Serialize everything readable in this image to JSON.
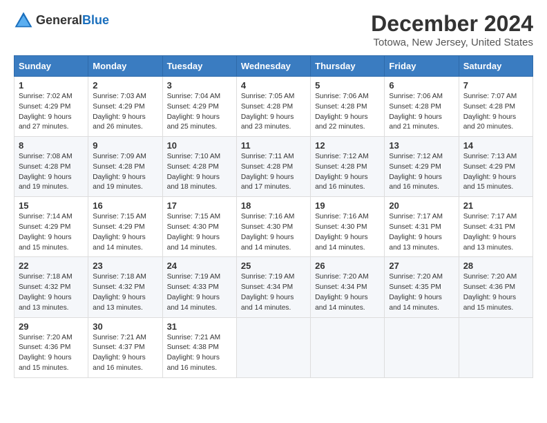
{
  "logo": {
    "general": "General",
    "blue": "Blue"
  },
  "title": "December 2024",
  "subtitle": "Totowa, New Jersey, United States",
  "days_header": [
    "Sunday",
    "Monday",
    "Tuesday",
    "Wednesday",
    "Thursday",
    "Friday",
    "Saturday"
  ],
  "weeks": [
    [
      {
        "day": "1",
        "sunrise": "Sunrise: 7:02 AM",
        "sunset": "Sunset: 4:29 PM",
        "daylight": "Daylight: 9 hours and 27 minutes."
      },
      {
        "day": "2",
        "sunrise": "Sunrise: 7:03 AM",
        "sunset": "Sunset: 4:29 PM",
        "daylight": "Daylight: 9 hours and 26 minutes."
      },
      {
        "day": "3",
        "sunrise": "Sunrise: 7:04 AM",
        "sunset": "Sunset: 4:29 PM",
        "daylight": "Daylight: 9 hours and 25 minutes."
      },
      {
        "day": "4",
        "sunrise": "Sunrise: 7:05 AM",
        "sunset": "Sunset: 4:28 PM",
        "daylight": "Daylight: 9 hours and 23 minutes."
      },
      {
        "day": "5",
        "sunrise": "Sunrise: 7:06 AM",
        "sunset": "Sunset: 4:28 PM",
        "daylight": "Daylight: 9 hours and 22 minutes."
      },
      {
        "day": "6",
        "sunrise": "Sunrise: 7:06 AM",
        "sunset": "Sunset: 4:28 PM",
        "daylight": "Daylight: 9 hours and 21 minutes."
      },
      {
        "day": "7",
        "sunrise": "Sunrise: 7:07 AM",
        "sunset": "Sunset: 4:28 PM",
        "daylight": "Daylight: 9 hours and 20 minutes."
      }
    ],
    [
      {
        "day": "8",
        "sunrise": "Sunrise: 7:08 AM",
        "sunset": "Sunset: 4:28 PM",
        "daylight": "Daylight: 9 hours and 19 minutes."
      },
      {
        "day": "9",
        "sunrise": "Sunrise: 7:09 AM",
        "sunset": "Sunset: 4:28 PM",
        "daylight": "Daylight: 9 hours and 19 minutes."
      },
      {
        "day": "10",
        "sunrise": "Sunrise: 7:10 AM",
        "sunset": "Sunset: 4:28 PM",
        "daylight": "Daylight: 9 hours and 18 minutes."
      },
      {
        "day": "11",
        "sunrise": "Sunrise: 7:11 AM",
        "sunset": "Sunset: 4:28 PM",
        "daylight": "Daylight: 9 hours and 17 minutes."
      },
      {
        "day": "12",
        "sunrise": "Sunrise: 7:12 AM",
        "sunset": "Sunset: 4:28 PM",
        "daylight": "Daylight: 9 hours and 16 minutes."
      },
      {
        "day": "13",
        "sunrise": "Sunrise: 7:12 AM",
        "sunset": "Sunset: 4:29 PM",
        "daylight": "Daylight: 9 hours and 16 minutes."
      },
      {
        "day": "14",
        "sunrise": "Sunrise: 7:13 AM",
        "sunset": "Sunset: 4:29 PM",
        "daylight": "Daylight: 9 hours and 15 minutes."
      }
    ],
    [
      {
        "day": "15",
        "sunrise": "Sunrise: 7:14 AM",
        "sunset": "Sunset: 4:29 PM",
        "daylight": "Daylight: 9 hours and 15 minutes."
      },
      {
        "day": "16",
        "sunrise": "Sunrise: 7:15 AM",
        "sunset": "Sunset: 4:29 PM",
        "daylight": "Daylight: 9 hours and 14 minutes."
      },
      {
        "day": "17",
        "sunrise": "Sunrise: 7:15 AM",
        "sunset": "Sunset: 4:30 PM",
        "daylight": "Daylight: 9 hours and 14 minutes."
      },
      {
        "day": "18",
        "sunrise": "Sunrise: 7:16 AM",
        "sunset": "Sunset: 4:30 PM",
        "daylight": "Daylight: 9 hours and 14 minutes."
      },
      {
        "day": "19",
        "sunrise": "Sunrise: 7:16 AM",
        "sunset": "Sunset: 4:30 PM",
        "daylight": "Daylight: 9 hours and 14 minutes."
      },
      {
        "day": "20",
        "sunrise": "Sunrise: 7:17 AM",
        "sunset": "Sunset: 4:31 PM",
        "daylight": "Daylight: 9 hours and 13 minutes."
      },
      {
        "day": "21",
        "sunrise": "Sunrise: 7:17 AM",
        "sunset": "Sunset: 4:31 PM",
        "daylight": "Daylight: 9 hours and 13 minutes."
      }
    ],
    [
      {
        "day": "22",
        "sunrise": "Sunrise: 7:18 AM",
        "sunset": "Sunset: 4:32 PM",
        "daylight": "Daylight: 9 hours and 13 minutes."
      },
      {
        "day": "23",
        "sunrise": "Sunrise: 7:18 AM",
        "sunset": "Sunset: 4:32 PM",
        "daylight": "Daylight: 9 hours and 13 minutes."
      },
      {
        "day": "24",
        "sunrise": "Sunrise: 7:19 AM",
        "sunset": "Sunset: 4:33 PM",
        "daylight": "Daylight: 9 hours and 14 minutes."
      },
      {
        "day": "25",
        "sunrise": "Sunrise: 7:19 AM",
        "sunset": "Sunset: 4:34 PM",
        "daylight": "Daylight: 9 hours and 14 minutes."
      },
      {
        "day": "26",
        "sunrise": "Sunrise: 7:20 AM",
        "sunset": "Sunset: 4:34 PM",
        "daylight": "Daylight: 9 hours and 14 minutes."
      },
      {
        "day": "27",
        "sunrise": "Sunrise: 7:20 AM",
        "sunset": "Sunset: 4:35 PM",
        "daylight": "Daylight: 9 hours and 14 minutes."
      },
      {
        "day": "28",
        "sunrise": "Sunrise: 7:20 AM",
        "sunset": "Sunset: 4:36 PM",
        "daylight": "Daylight: 9 hours and 15 minutes."
      }
    ],
    [
      {
        "day": "29",
        "sunrise": "Sunrise: 7:20 AM",
        "sunset": "Sunset: 4:36 PM",
        "daylight": "Daylight: 9 hours and 15 minutes."
      },
      {
        "day": "30",
        "sunrise": "Sunrise: 7:21 AM",
        "sunset": "Sunset: 4:37 PM",
        "daylight": "Daylight: 9 hours and 16 minutes."
      },
      {
        "day": "31",
        "sunrise": "Sunrise: 7:21 AM",
        "sunset": "Sunset: 4:38 PM",
        "daylight": "Daylight: 9 hours and 16 minutes."
      },
      null,
      null,
      null,
      null
    ]
  ]
}
